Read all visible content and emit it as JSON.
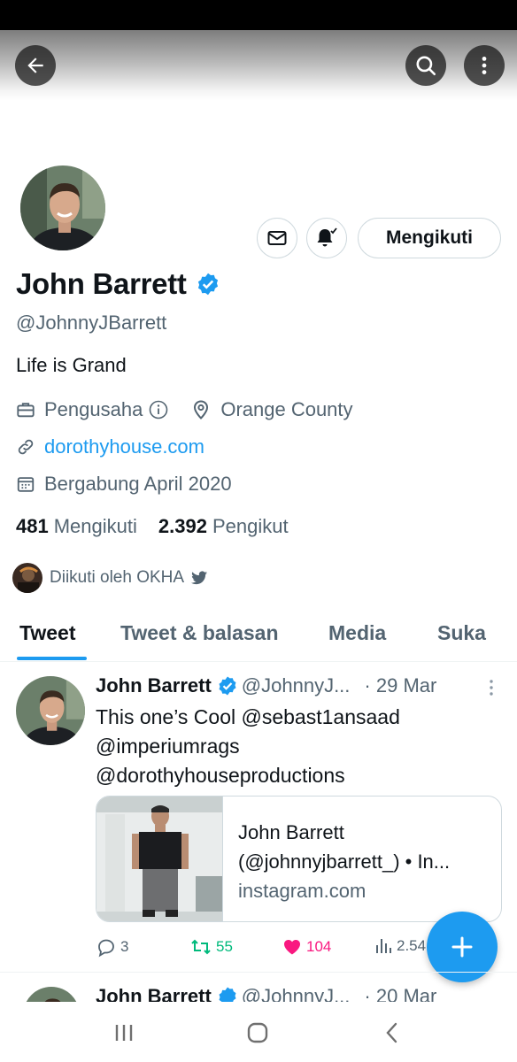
{
  "profile": {
    "name": "John Barrett",
    "handle": "@JohnnyJBarrett",
    "bio": "Life is Grand",
    "category": "Pengusaha",
    "location": "Orange County",
    "website": "dorothyhouse.com",
    "joined": "Bergabung April 2020",
    "following_count": "481",
    "following_label": "Mengikuti",
    "followers_count": "2.392",
    "followers_label": "Pengikut",
    "followed_by": "Diikuti oleh OKHA"
  },
  "header": {
    "follow_button": "Mengikuti"
  },
  "tabs": [
    {
      "label": "Tweet",
      "active": true
    },
    {
      "label": "Tweet & balasan",
      "active": false
    },
    {
      "label": "Media",
      "active": false
    },
    {
      "label": "Suka",
      "active": false
    }
  ],
  "tweets": [
    {
      "name": "John Barrett",
      "handle": "@JohnnyJ...",
      "date": "· 29 Mar",
      "text_line1": "This one’s Cool @sebast1ansaad",
      "text_line2": "@imperiumrags",
      "text_line3": "@dorothyhouseproductions",
      "card": {
        "title_line1": "John Barrett",
        "title_line2": "(@johnnyjbarrett_) • In...",
        "domain": "instagram.com"
      },
      "replies": "3",
      "retweets": "55",
      "likes": "104",
      "views": "2.54"
    },
    {
      "name": "John Barrett",
      "handle": "@JohnnyJ...",
      "date": "· 20 Mar"
    }
  ],
  "colors": {
    "accent": "#1d9bf0",
    "retweet": "#00ba7c",
    "like": "#f91880",
    "secondary_text": "#536471"
  }
}
